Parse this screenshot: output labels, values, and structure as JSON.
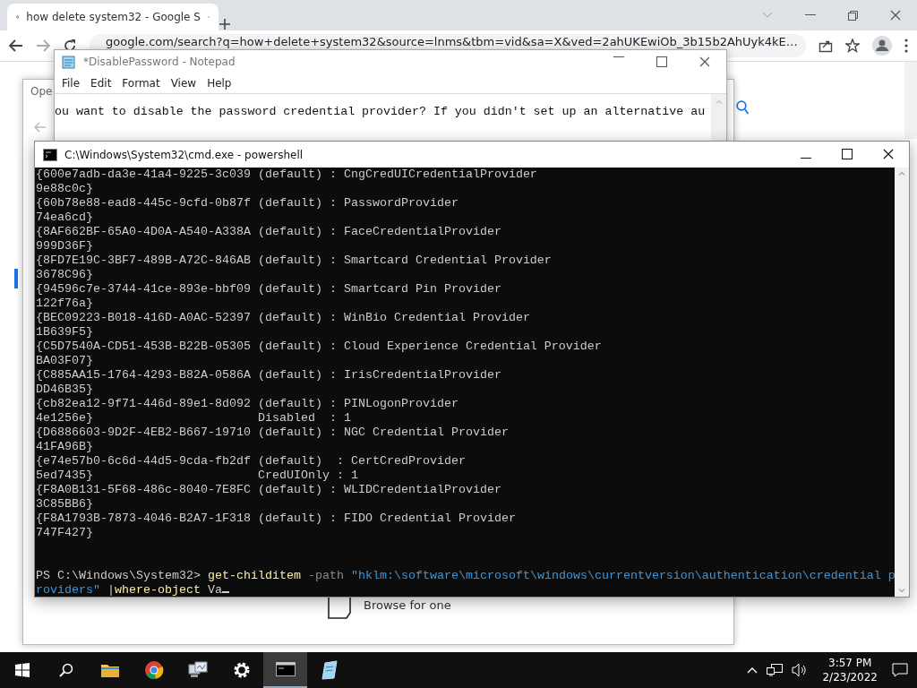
{
  "browser": {
    "tab_title": "how delete system32 - Google S",
    "url": "google.com/search?q=how+delete+system32&source=lnms&tbm=vid&sa=X&ved=2ahUKEwiOb_3b15b2AhUyk4kE…"
  },
  "dialog": {
    "title": "Ope",
    "option": "Browse for one"
  },
  "notepad": {
    "title": "*DisablePassword - Notepad",
    "menu": [
      "File",
      "Edit",
      "Format",
      "View",
      "Help"
    ],
    "text": "ou want to disable the password credential provider? If you didn't set up an alternative au"
  },
  "console": {
    "title": "C:\\Windows\\System32\\cmd.exe - powershell",
    "lines": [
      "{600e7adb-da3e-41a4-9225-3c039 (default) : CngCredUICredentialProvider",
      "9e88c0c}",
      "{60b78e88-ead8-445c-9cfd-0b87f (default) : PasswordProvider",
      "74ea6cd}",
      "{8AF662BF-65A0-4D0A-A540-A338A (default) : FaceCredentialProvider",
      "999D36F}",
      "{8FD7E19C-3BF7-489B-A72C-846AB (default) : Smartcard Credential Provider",
      "3678C96}",
      "{94596c7e-3744-41ce-893e-bbf09 (default) : Smartcard Pin Provider",
      "122f76a}",
      "{BEC09223-B018-416D-A0AC-52397 (default) : WinBio Credential Provider",
      "1B639F5}",
      "{C5D7540A-CD51-453B-B22B-05305 (default) : Cloud Experience Credential Provider",
      "BA03F07}",
      "{C885AA15-1764-4293-B82A-0586A (default) : IrisCredentialProvider",
      "DD46B35}",
      "{cb82ea12-9f71-446d-89e1-8d092 (default) : PINLogonProvider",
      "4e1256e}                       Disabled  : 1",
      "{D6886603-9D2F-4EB2-B667-19710 (default) : NGC Credential Provider",
      "41FA96B}",
      "{e74e57b0-6c6d-44d5-9cda-fb2df (default)  : CertCredProvider",
      "5ed7435}                       CredUIOnly : 1",
      "{F8A0B131-5F68-486c-8040-7E8FC (default) : WLIDCredentialProvider",
      "3C85BB6}",
      "{F8A1793B-7873-4046-B2A7-1F318 (default) : FIDO Credential Provider",
      "747F427}"
    ],
    "command_lines": [
      [
        {
          "kind": "prompt",
          "text": "PS C:\\Windows\\System32> "
        },
        {
          "kind": "command",
          "text": "get-childitem"
        },
        {
          "kind": "parameter",
          "text": " -path "
        },
        {
          "kind": "string",
          "text": "\"hklm:\\software\\microsoft\\windows\\currentversion\\authentication\\credential p"
        }
      ],
      [
        {
          "kind": "string",
          "text": "roviders\""
        },
        {
          "kind": "plain",
          "text": " |"
        },
        {
          "kind": "command",
          "text": "where-object"
        },
        {
          "kind": "plain",
          "text": " Va"
        }
      ]
    ]
  },
  "taskbar": {
    "time": "3:57 PM",
    "date": "2/23/2022"
  }
}
